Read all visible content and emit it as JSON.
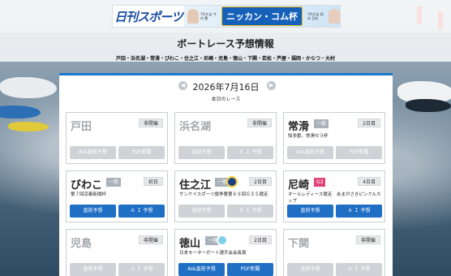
{
  "banner": {
    "logo": "日刊スポーツ",
    "promo_left_caption": "7代大吉 今村 豊",
    "promo_cup": "ニッカン・コム杯",
    "promo_right_caption": "7代大吉 松本 日向"
  },
  "header": {
    "title": "ボートレース予想情報",
    "venues": "戸田・浜名湖・常滑・びわこ・住之江・尼崎・児島・徳山・下関・若松・芦屋・福岡・からつ・大村"
  },
  "date_nav": {
    "prev_icon": "◀",
    "next_icon": "▶",
    "date": "2026年7月16日",
    "subtitle": "本日のレース"
  },
  "cards": [
    {
      "name": "戸田",
      "status": "非開催",
      "desc": "",
      "buttons": [
        "AI&直前予想",
        "PDF新聞"
      ],
      "active": false
    },
    {
      "name": "浜名湖",
      "status": "非開催",
      "desc": "",
      "buttons": [
        "直前予想",
        "Ａ Ｉ 予想"
      ],
      "active": false
    },
    {
      "name": "常滑",
      "grade": "一般",
      "status": "2日目",
      "desc": "知多郡、常滑セラ杯",
      "buttons": [
        "AI&直前予想",
        "PDF新聞"
      ],
      "active": false
    },
    {
      "name": "びわこ",
      "grade": "一般",
      "status": "初日",
      "desc": "第７回京都新聞杯",
      "buttons": [
        "直前予想",
        "Ａ Ｉ 予想"
      ],
      "active": true
    },
    {
      "name": "住之江",
      "grade": "一般",
      "status": "2日目",
      "desc": "サンケイスポーツ旗争奪第６９回ＧＳＳ競走",
      "buttons": [
        "直前予想",
        "Ａ Ｉ 予想"
      ],
      "active": false
    },
    {
      "name": "尼崎",
      "grade": "G3",
      "status": "4日目",
      "desc": "オールレディース競走　あまがさきピンクルカップ",
      "buttons": [
        "直前予想",
        "Ａ Ｉ 予想"
      ],
      "active": true
    },
    {
      "name": "児島",
      "status": "非開催",
      "desc": "",
      "buttons": [
        "直前予想",
        "Ａ Ｉ 予想"
      ],
      "active": false
    },
    {
      "name": "徳山",
      "grade": "一般",
      "status": "2日目",
      "desc": "日本モーターボート選手会会長賞",
      "buttons": [
        "AI&直前予想",
        "PDF新聞"
      ],
      "active": true
    },
    {
      "name": "下関",
      "status": "非開催",
      "desc": "",
      "buttons": [
        "直前予想",
        "Ａ Ｉ 予想"
      ],
      "active": false
    }
  ],
  "colors": {
    "accent": "#1f6fc5",
    "g3": "#e0457a",
    "disabled": "#cfd3d7"
  }
}
